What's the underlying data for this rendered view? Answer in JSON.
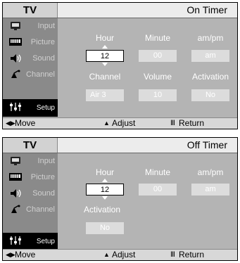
{
  "panels": [
    {
      "header": {
        "tv": "TV",
        "title": "On Timer"
      },
      "sidebar": [
        "Input",
        "Picture",
        "Sound",
        "Channel",
        "Setup"
      ],
      "labels": {
        "hour": "Hour",
        "minute": "Minute",
        "ampm": "am/pm",
        "channel": "Channel",
        "volume": "Volume",
        "activation": "Activation"
      },
      "values": {
        "hour": "12",
        "minute": "00",
        "ampm": "am",
        "channel": "Air   3",
        "volume": "10",
        "activation": "No"
      },
      "footer": {
        "move": "Move",
        "adjust": "Adjust",
        "ret": "Return"
      }
    },
    {
      "header": {
        "tv": "TV",
        "title": "Off Timer"
      },
      "sidebar": [
        "Input",
        "Picture",
        "Sound",
        "Channel",
        "Setup"
      ],
      "labels": {
        "hour": "Hour",
        "minute": "Minute",
        "ampm": "am/pm",
        "activation": "Activation"
      },
      "values": {
        "hour": "12",
        "minute": "00",
        "ampm": "am",
        "activation": "No"
      },
      "footer": {
        "move": "Move",
        "adjust": "Adjust",
        "ret": "Return"
      }
    }
  ],
  "icons": {
    "input": "input-icon",
    "picture": "picture-icon",
    "sound": "sound-icon",
    "channel": "channel-icon",
    "setup": "setup-icon",
    "move": "move-arrows-icon",
    "adjust": "adjust-arrows-icon",
    "return": "return-icon"
  },
  "colors": {
    "panel": "#b4b4b4",
    "sidebar": "#8a8a8a",
    "active": "#000000",
    "header": "#ececec"
  }
}
